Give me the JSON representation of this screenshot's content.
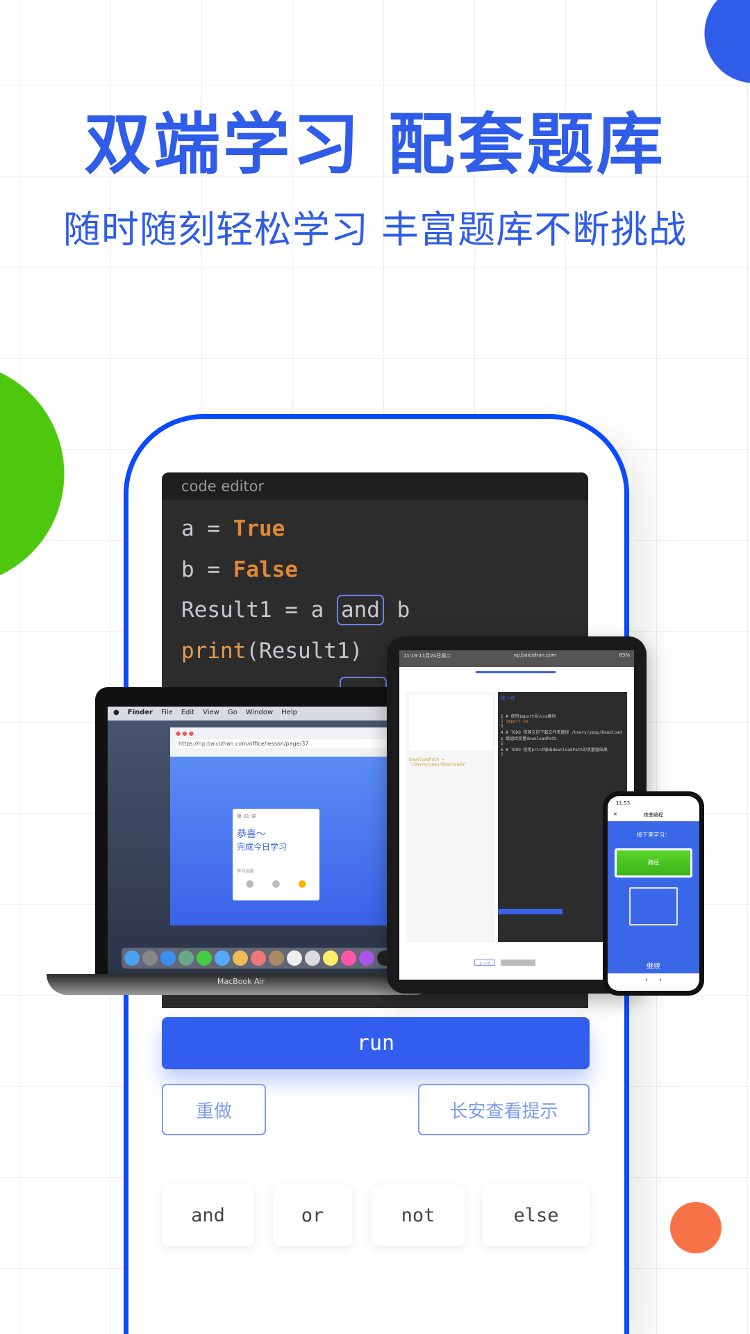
{
  "colors": {
    "accent": "#2f5ce8",
    "frame": "#0a4bff",
    "run_button": "#325ef0",
    "green_circle": "#4ec80e",
    "blue_circle": "#2f5ce8",
    "orange_circle": "#f97349"
  },
  "header": {
    "title": "双端学习 配套题库",
    "subtitle": "随时随刻轻松学习 丰富题库不断挑战"
  },
  "editor": {
    "title": "code editor",
    "lines": [
      {
        "pre": "a = ",
        "kw": "True"
      },
      {
        "pre": "b = ",
        "kw": "False"
      },
      {
        "pre": "Result1 = a ",
        "boxed": "and",
        "post": " b"
      },
      {
        "fn": "print",
        "post": "(Result1)"
      }
    ]
  },
  "devices": {
    "laptop": {
      "menu": [
        "Finder",
        "File",
        "Edit",
        "View",
        "Go",
        "Window",
        "Help"
      ],
      "label": "MacBook Air",
      "url": "https://np.baicizhan.com/office/lesson/page/37",
      "lesson": "第 01 课",
      "congrats": "恭喜～",
      "done": "完成今日学习",
      "summary": "学习总结"
    },
    "tablet": {
      "status": "11:19  11月24日周二",
      "battery": "83%",
      "url": "np.baicizhan.com",
      "panel_title": "练一练",
      "code": [
        "1 # 使用import导入os模块",
        "2 import os",
        "3",
        "4 # TODO 将网文的下载文件夹路径 /Users/yequ/Download",
        "  s 赋值给变量downloadPath",
        "5",
        "6 # TODO 使用print输出downloadPath的变量值结果",
        "7"
      ],
      "prev": "上一页"
    },
    "phone": {
      "time": "11:53",
      "app_title": "夜曲编程",
      "next": "接下来学习：",
      "topic": "路径",
      "continue": "继续"
    }
  },
  "actions": {
    "run": "run",
    "redo": "重做",
    "hint": "长安查看提示"
  },
  "keywords": [
    "and",
    "or",
    "not",
    "else"
  ]
}
